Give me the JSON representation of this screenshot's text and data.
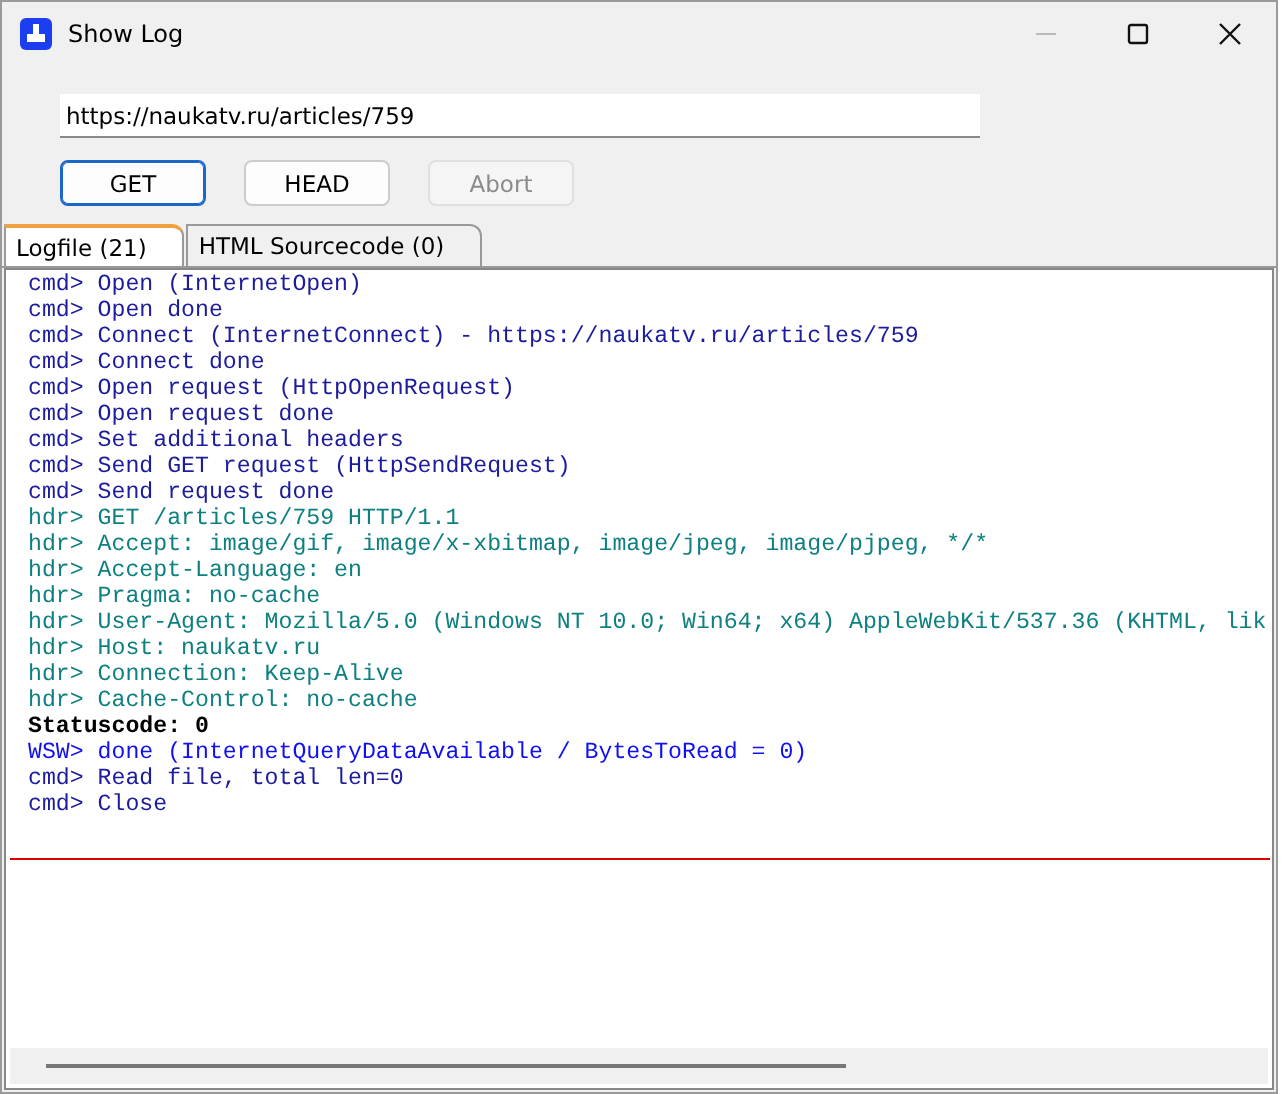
{
  "window": {
    "title": "Show Log"
  },
  "url_field": {
    "value": "https://naukatv.ru/articles/759"
  },
  "buttons": [
    {
      "label": "GET",
      "default": true,
      "disabled": false
    },
    {
      "label": "HEAD",
      "default": false,
      "disabled": false
    },
    {
      "label": "Abort",
      "default": false,
      "disabled": true
    }
  ],
  "tabs": [
    {
      "label": "Logfile  (21)",
      "selected": true
    },
    {
      "label": "HTML Sourcecode  (0)",
      "selected": false
    }
  ],
  "log": [
    {
      "kind": "cmd",
      "text": "cmd> Open (InternetOpen)"
    },
    {
      "kind": "cmd",
      "text": "cmd> Open done"
    },
    {
      "kind": "cmd",
      "text": "cmd> Connect (InternetConnect) - https://naukatv.ru/articles/759"
    },
    {
      "kind": "cmd",
      "text": "cmd> Connect done"
    },
    {
      "kind": "cmd",
      "text": "cmd> Open request (HttpOpenRequest)"
    },
    {
      "kind": "cmd",
      "text": "cmd> Open request done"
    },
    {
      "kind": "cmd",
      "text": "cmd> Set additional headers"
    },
    {
      "kind": "cmd",
      "text": "cmd> Send GET request (HttpSendRequest)"
    },
    {
      "kind": "cmd",
      "text": "cmd> Send request done"
    },
    {
      "kind": "hdr",
      "text": "hdr> GET /articles/759 HTTP/1.1"
    },
    {
      "kind": "hdr",
      "text": "hdr> Accept: image/gif, image/x-xbitmap, image/jpeg, image/pjpeg, */*"
    },
    {
      "kind": "hdr",
      "text": "hdr> Accept-Language: en"
    },
    {
      "kind": "hdr",
      "text": "hdr> Pragma: no-cache"
    },
    {
      "kind": "hdr",
      "text": "hdr> User-Agent: Mozilla/5.0 (Windows NT 10.0; Win64; x64) AppleWebKit/537.36 (KHTML, lik"
    },
    {
      "kind": "hdr",
      "text": "hdr> Host: naukatv.ru"
    },
    {
      "kind": "hdr",
      "text": "hdr> Connection: Keep-Alive"
    },
    {
      "kind": "hdr",
      "text": "hdr> Cache-Control: no-cache"
    },
    {
      "kind": "status",
      "text": "Statuscode: 0"
    },
    {
      "kind": "wsw",
      "text": "WSW> done (InternetQueryDataAvailable / BytesToRead = 0)"
    },
    {
      "kind": "cmd",
      "text": "cmd> Read file, total len=0"
    },
    {
      "kind": "cmd",
      "text": "cmd> Close"
    }
  ]
}
